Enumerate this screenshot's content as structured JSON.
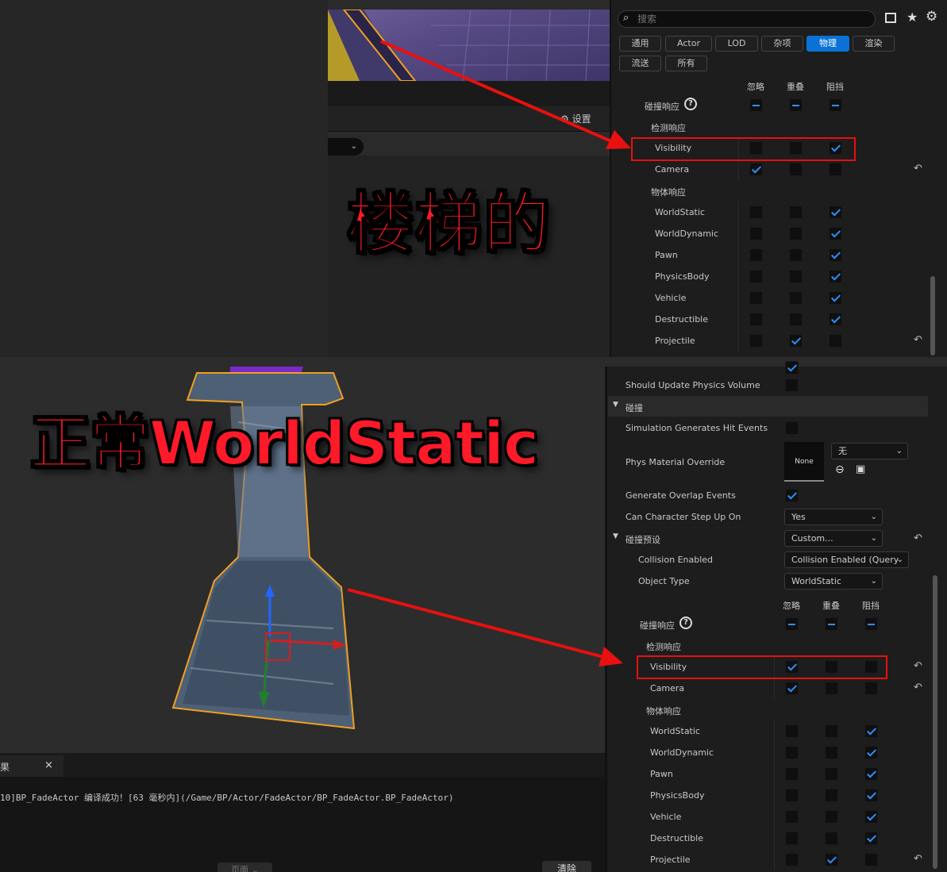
{
  "top_panel": {
    "search_placeholder": "搜索",
    "tabs": [
      "通用",
      "Actor",
      "LOD",
      "杂项",
      "物理",
      "渲染",
      "流送",
      "所有"
    ],
    "active_tab": "物理",
    "col_headers": [
      "忽略",
      "重叠",
      "阻挡"
    ],
    "collision_response_label": "碰撞响应",
    "trace_response_label": "检测响应",
    "object_response_label": "物体响应",
    "rows": [
      {
        "name": "Visibility",
        "values": [
          false,
          false,
          true
        ],
        "reset": false
      },
      {
        "name": "Camera",
        "values": [
          true,
          false,
          false
        ],
        "reset": true
      },
      {
        "name": "WorldStatic",
        "values": [
          false,
          false,
          true
        ],
        "reset": false
      },
      {
        "name": "WorldDynamic",
        "values": [
          false,
          false,
          true
        ],
        "reset": false
      },
      {
        "name": "Pawn",
        "values": [
          false,
          false,
          true
        ],
        "reset": false
      },
      {
        "name": "PhysicsBody",
        "values": [
          false,
          false,
          true
        ],
        "reset": false
      },
      {
        "name": "Vehicle",
        "values": [
          false,
          false,
          true
        ],
        "reset": false
      },
      {
        "name": "Destructible",
        "values": [
          false,
          false,
          true
        ],
        "reset": false
      },
      {
        "name": "Projectile",
        "values": [
          false,
          true,
          false
        ],
        "reset": true
      }
    ],
    "settings_label": "设置"
  },
  "annotations": {
    "stairs": "楼梯的",
    "normal": "正常WorldStatic"
  },
  "bottom_panel": {
    "should_update_label": "Should Update Physics Volume",
    "collision_section": "碰撞",
    "sim_hit_label": "Simulation Generates Hit Events",
    "phys_mat_label": "Phys Material Override",
    "phys_mat_thumb": "None",
    "phys_mat_value": "无",
    "gen_overlap_label": "Generate Overlap Events",
    "step_up_label": "Can Character Step Up On",
    "step_up_value": "Yes",
    "preset_label": "碰撞预设",
    "preset_value": "Custom...",
    "collision_enabled_label": "Collision Enabled",
    "collision_enabled_value": "Collision Enabled (Query",
    "object_type_label": "Object Type",
    "object_type_value": "WorldStatic",
    "col_headers": [
      "忽略",
      "重叠",
      "阻挡"
    ],
    "collision_response_label": "碰撞响应",
    "trace_response_label": "检测响应",
    "object_response_label": "物体响应",
    "rows": [
      {
        "name": "Visibility",
        "values": [
          true,
          false,
          false
        ],
        "reset": true
      },
      {
        "name": "Camera",
        "values": [
          true,
          false,
          false
        ],
        "reset": true
      },
      {
        "name": "WorldStatic",
        "values": [
          false,
          false,
          true
        ],
        "reset": false
      },
      {
        "name": "WorldDynamic",
        "values": [
          false,
          false,
          true
        ],
        "reset": false
      },
      {
        "name": "Pawn",
        "values": [
          false,
          false,
          true
        ],
        "reset": false
      },
      {
        "name": "PhysicsBody",
        "values": [
          false,
          false,
          true
        ],
        "reset": false
      },
      {
        "name": "Vehicle",
        "values": [
          false,
          false,
          true
        ],
        "reset": false
      },
      {
        "name": "Destructible",
        "values": [
          false,
          false,
          true
        ],
        "reset": false
      },
      {
        "name": "Projectile",
        "values": [
          false,
          true,
          false
        ],
        "reset": true
      }
    ]
  },
  "output_log": {
    "tab_label": "果",
    "close_glyph": "×",
    "message": "10]BP_FadeActor 编译成功！[63 毫秒内](/Game/BP/Actor/FadeActor/BP_FadeActor.BP_FadeActor)",
    "page_button": "页面",
    "clear_button": "清除"
  },
  "colors": {
    "accent": "#0a72d6",
    "check": "#2f8fff",
    "annotation_red": "#e81010",
    "selection_orange": "#f0a020"
  }
}
